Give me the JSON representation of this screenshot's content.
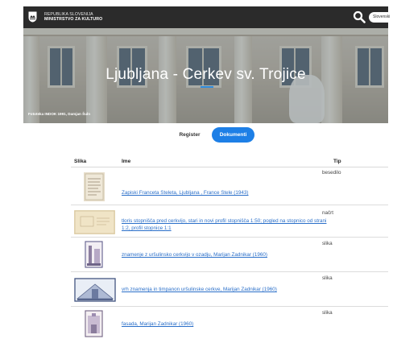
{
  "header": {
    "org_line1": "REPUBLIKA SLOVENIJA",
    "org_line2": "MINISTRSTVO ZA KULTURO",
    "search_icon": "search-icon",
    "language_label": "Slovenski"
  },
  "hero": {
    "title": "Ljubljana - Cerkev sv. Trojice",
    "photo_credit": "Fototeka INDOK 1991, Damjan Šuln"
  },
  "tabs": [
    {
      "label": "Register",
      "active": false
    },
    {
      "label": "Dokumenti",
      "active": true
    }
  ],
  "table": {
    "columns": [
      "Slika",
      "Ime",
      "Tip"
    ],
    "rows": [
      {
        "name": "Zapiski Franceta Steleta, Ljubljana , France Stele (1943)",
        "type": "besedilo"
      },
      {
        "name": "tloris stopnišča pred cerkvijo, stari in novi profil stopnišča 1:50; pogled na stopnico od strani 1:2, profil stopnice 1:1",
        "type": "načrt"
      },
      {
        "name": "znamenje z uršulinsko cerkvijo v ozadju, Marijan Zadnikar (1960)",
        "type": "slika"
      },
      {
        "name": "vrh znamenja in timpanon uršulinske cerkve, Marijan Zadnikar (1960)",
        "type": "slika"
      },
      {
        "name": "fasada, Marijan Zadnikar (1960)",
        "type": "slika"
      }
    ]
  },
  "colors": {
    "topbar": "#2b2b2b",
    "accent": "#1d7fe6",
    "link": "#2a6fc9"
  }
}
